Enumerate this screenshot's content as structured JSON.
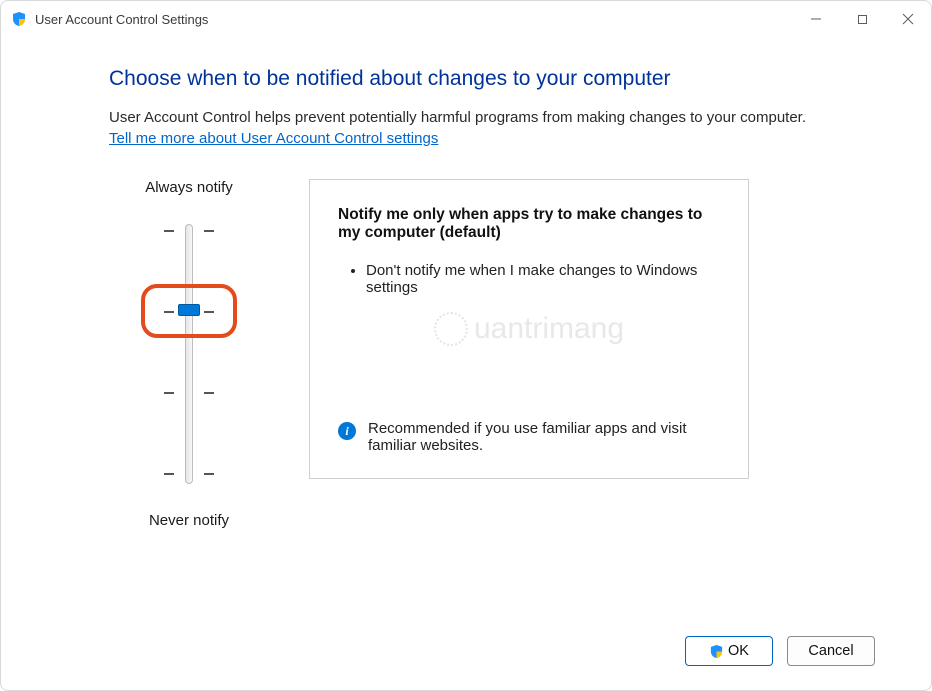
{
  "window": {
    "title": "User Account Control Settings"
  },
  "heading": "Choose when to be notified about changes to your computer",
  "description": "User Account Control helps prevent potentially harmful programs from making changes to your computer.",
  "help_link": "Tell me more about User Account Control settings",
  "slider": {
    "top_label": "Always notify",
    "bottom_label": "Never notify",
    "levels": 4,
    "selected_index": 1
  },
  "panel": {
    "title": "Notify me only when apps try to make changes to my computer (default)",
    "bullets": [
      "Don't notify me when I make changes to Windows settings"
    ],
    "recommendation": "Recommended if you use familiar apps and visit familiar websites."
  },
  "buttons": {
    "ok": "OK",
    "cancel": "Cancel"
  },
  "colors": {
    "accent": "#0078d7",
    "heading": "#003399",
    "link": "#0066cc",
    "highlight": "#e34a1c"
  }
}
